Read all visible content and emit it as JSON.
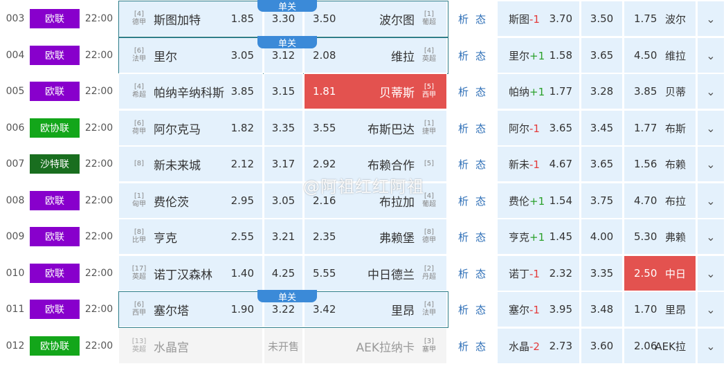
{
  "watermark": "@阿祖红红阿祖",
  "single_label": "单关",
  "analysis_label": "析",
  "status_label": "态",
  "more_icon": "chevron-down-icon",
  "league_colors": {
    "欧联": "#8800cc",
    "欧协联": "#13a61a",
    "沙特联": "#196e1f"
  },
  "matches": [
    {
      "num": "003",
      "league": "欧联",
      "time": "22:00",
      "home_rank": "[4]",
      "home_league": "德甲",
      "home": "斯图加特",
      "odds": [
        "1.85",
        "3.30",
        "3.50"
      ],
      "away": "波尔图",
      "away_rank": "[1]",
      "away_league": "葡超",
      "single": true,
      "hcp_team": "斯图",
      "hcp": "-1",
      "hcp_odds": [
        "3.70",
        "3.50",
        "1.75"
      ],
      "hcp_away": "波尔"
    },
    {
      "num": "004",
      "league": "欧联",
      "time": "22:00",
      "home_rank": "[6]",
      "home_league": "法甲",
      "home": "里尔",
      "odds": [
        "3.05",
        "3.12",
        "2.08"
      ],
      "away": "维拉",
      "away_rank": "[4]",
      "away_league": "英超",
      "single": true,
      "hcp_team": "里尔",
      "hcp": "+1",
      "hcp_odds": [
        "1.58",
        "3.65",
        "4.50"
      ],
      "hcp_away": "维拉"
    },
    {
      "num": "005",
      "league": "欧联",
      "time": "22:00",
      "home_rank": "[4]",
      "home_league": "希超",
      "home": "帕纳辛纳科斯",
      "odds": [
        "3.85",
        "3.15",
        "1.81"
      ],
      "away": "贝蒂斯",
      "away_rank": "[5]",
      "away_league": "西甲",
      "selected": 2,
      "hcp_team": "帕纳",
      "hcp": "+1",
      "hcp_odds": [
        "1.77",
        "3.28",
        "3.85"
      ],
      "hcp_away": "贝蒂"
    },
    {
      "num": "006",
      "league": "欧协联",
      "time": "22:00",
      "home_rank": "[6]",
      "home_league": "荷甲",
      "home": "阿尔克马",
      "odds": [
        "1.82",
        "3.35",
        "3.55"
      ],
      "away": "布斯巴达",
      "away_rank": "[1]",
      "away_league": "捷甲",
      "hcp_team": "阿尔",
      "hcp": "-1",
      "hcp_odds": [
        "3.65",
        "3.45",
        "1.77"
      ],
      "hcp_away": "布斯"
    },
    {
      "num": "007",
      "league": "沙特联",
      "time": "22:00",
      "home_rank": "[8]",
      "home_league": "",
      "home": "新未来城",
      "odds": [
        "2.12",
        "3.17",
        "2.92"
      ],
      "away": "布赖合作",
      "away_rank": "[5]",
      "away_league": "",
      "hcp_team": "新未",
      "hcp": "-1",
      "hcp_odds": [
        "4.67",
        "3.65",
        "1.56"
      ],
      "hcp_away": "布赖"
    },
    {
      "num": "008",
      "league": "欧联",
      "time": "22:00",
      "home_rank": "[1]",
      "home_league": "匈甲",
      "home": "费伦茨",
      "odds": [
        "2.95",
        "3.05",
        "2.16"
      ],
      "away": "布拉加",
      "away_rank": "[4]",
      "away_league": "葡超",
      "hcp_team": "费伦",
      "hcp": "+1",
      "hcp_odds": [
        "1.54",
        "3.75",
        "4.70"
      ],
      "hcp_away": "布拉"
    },
    {
      "num": "009",
      "league": "欧联",
      "time": "22:00",
      "home_rank": "[8]",
      "home_league": "比甲",
      "home": "亨克",
      "odds": [
        "2.55",
        "3.21",
        "2.35"
      ],
      "away": "弗赖堡",
      "away_rank": "[8]",
      "away_league": "德甲",
      "hcp_team": "亨克",
      "hcp": "+1",
      "hcp_odds": [
        "1.45",
        "4.00",
        "5.30"
      ],
      "hcp_away": "弗赖"
    },
    {
      "num": "010",
      "league": "欧联",
      "time": "22:00",
      "home_rank": "[17]",
      "home_league": "英超",
      "home": "诺丁汉森林",
      "odds": [
        "1.40",
        "4.25",
        "5.55"
      ],
      "away": "中日德兰",
      "away_rank": "[2]",
      "away_league": "丹超",
      "hcp_team": "诺丁",
      "hcp": "-1",
      "hcp_odds": [
        "2.32",
        "3.35",
        "2.50"
      ],
      "hcp_away": "中日",
      "hcp_selected": 2
    },
    {
      "num": "011",
      "league": "欧联",
      "time": "22:00",
      "home_rank": "[6]",
      "home_league": "西甲",
      "home": "塞尔塔",
      "odds": [
        "1.90",
        "3.22",
        "3.42"
      ],
      "away": "里昂",
      "away_rank": "[4]",
      "away_league": "法甲",
      "single": true,
      "hcp_team": "塞尔",
      "hcp": "-1",
      "hcp_odds": [
        "3.95",
        "3.48",
        "1.70"
      ],
      "hcp_away": "里昂"
    },
    {
      "num": "012",
      "league": "欧协联",
      "time": "22:00",
      "home_rank": "[13]",
      "home_league": "英超",
      "home": "水晶宫",
      "not_on_sale": "未开售",
      "away": "AEK拉纳卡",
      "away_rank": "[3]",
      "away_league": "塞甲",
      "hcp_team": "水晶",
      "hcp": "-2",
      "hcp_odds": [
        "2.73",
        "3.60",
        "2.06"
      ],
      "hcp_away": "AEK拉"
    }
  ]
}
